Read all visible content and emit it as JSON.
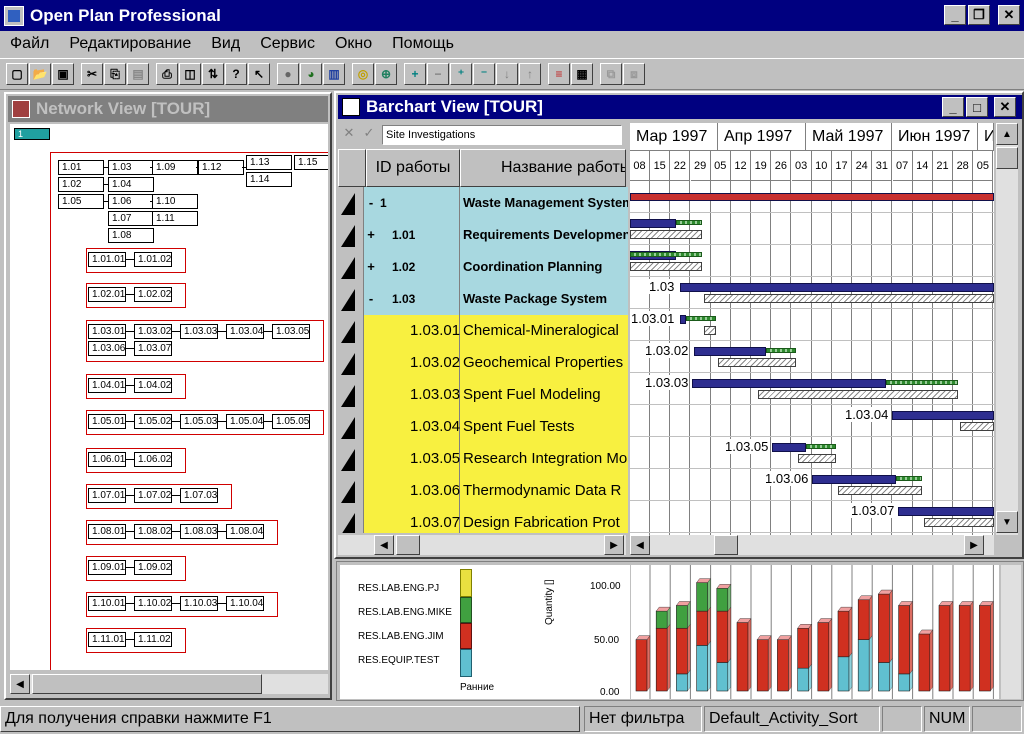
{
  "app": {
    "title": "Open Plan Professional"
  },
  "menu": [
    "Файл",
    "Редактирование",
    "Вид",
    "Сервис",
    "Окно",
    "Помощь"
  ],
  "network": {
    "title": "Network View [TOUR]",
    "root": "1",
    "top_nodes": [
      "1.01",
      "1.02",
      "1.05",
      "1.03",
      "1.04",
      "1.06",
      "1.07",
      "1.08",
      "1.10",
      "1.09",
      "1.11",
      "1.12",
      "1.13",
      "1.14",
      "1.15"
    ],
    "groups": [
      [
        "1.01.01",
        "1.01.02"
      ],
      [
        "1.02.01",
        "1.02.02"
      ],
      [
        "1.03.01",
        "1.03.02",
        "1.03.03",
        "1.03.04",
        "1.03.05",
        "1.03.06",
        "1.03.07"
      ],
      [
        "1.04.01",
        "1.04.02"
      ],
      [
        "1.05.01",
        "1.05.02",
        "1.05.03",
        "1.05.04",
        "1.05.05"
      ],
      [
        "1.06.01",
        "1.06.02"
      ],
      [
        "1.07.01",
        "1.07.02",
        "1.07.03"
      ],
      [
        "1.08.01",
        "1.08.02",
        "1.08.03",
        "1.08.04"
      ],
      [
        "1.09.01",
        "1.09.02"
      ],
      [
        "1.10.01",
        "1.10.02",
        "1.10.03",
        "1.10.04"
      ],
      [
        "1.11.01",
        "1.11.02"
      ]
    ]
  },
  "barchart": {
    "title": "Barchart View [TOUR]",
    "edit_value": "Site Investigations",
    "col_id": "ID работы",
    "col_name": "Название работы",
    "months": [
      "Мар 1997",
      "Апр 1997",
      "Май 1997",
      "Июн 1997",
      "И"
    ],
    "days": [
      "08",
      "15",
      "22",
      "29",
      "05",
      "12",
      "19",
      "26",
      "03",
      "10",
      "17",
      "24",
      "31",
      "07",
      "14",
      "21",
      "28",
      "05"
    ],
    "rows": [
      {
        "toggle": "-",
        "id": "1",
        "name": "Waste Management System",
        "label": "",
        "bg": "#a8d8e0",
        "bold": true
      },
      {
        "toggle": "+",
        "id": "1.01",
        "name": "Requirements Development",
        "label": "",
        "bg": "#a8d8e0",
        "bold": true
      },
      {
        "toggle": "+",
        "id": "1.02",
        "name": "Coordination Planning",
        "label": "",
        "bg": "#a8d8e0",
        "bold": true
      },
      {
        "toggle": "-",
        "id": "1.03",
        "name": "Waste Package System",
        "label": "1.03",
        "bg": "#a8d8e0",
        "bold": true
      },
      {
        "toggle": "",
        "id": "1.03.01",
        "name": "Chemical-Mineralogical",
        "label": "1.03.01",
        "bg": "#f8f040",
        "bold": false
      },
      {
        "toggle": "",
        "id": "1.03.02",
        "name": "Geochemical Properties",
        "label": "1.03.02",
        "bg": "#f8f040",
        "bold": false
      },
      {
        "toggle": "",
        "id": "1.03.03",
        "name": "Spent Fuel Modeling",
        "label": "1.03.03",
        "bg": "#f8f040",
        "bold": false
      },
      {
        "toggle": "",
        "id": "1.03.04",
        "name": "Spent Fuel Tests",
        "label": "1.03.04",
        "bg": "#f8f040",
        "bold": false
      },
      {
        "toggle": "",
        "id": "1.03.05",
        "name": "Research Integration Mo",
        "label": "1.03.05",
        "bg": "#f8f040",
        "bold": false
      },
      {
        "toggle": "",
        "id": "1.03.06",
        "name": "Thermodynamic Data R",
        "label": "1.03.06",
        "bg": "#f8f040",
        "bold": false
      },
      {
        "toggle": "",
        "id": "1.03.07",
        "name": "Design Fabrication Prot",
        "label": "1.03.07",
        "bg": "#f8f040",
        "bold": false
      }
    ]
  },
  "resources": {
    "legend": [
      "RES.LAB.ENG.PJ",
      "RES.LAB.ENG.MIKE",
      "RES.LAB.ENG.JIM",
      "RES.EQUIP.TEST"
    ],
    "legend_colors": [
      "#e8e040",
      "#40a040",
      "#d03020",
      "#60c0d0"
    ],
    "legend_caption": "Ранние",
    "ylabel": "Quantity []",
    "yticks": [
      "100.00",
      "50.00",
      "0.00"
    ]
  },
  "chart_data": {
    "type": "bar",
    "title": "",
    "ylabel": "Quantity []",
    "ylim": [
      0,
      100
    ],
    "series": [
      {
        "name": "RES.EQUIP.TEST",
        "values": [
          0,
          0,
          15,
          40,
          25,
          0,
          0,
          0,
          20,
          0,
          30,
          45,
          25,
          15,
          0,
          0,
          0,
          0
        ]
      },
      {
        "name": "RES.LAB.ENG.JIM",
        "values": [
          45,
          55,
          40,
          30,
          45,
          60,
          45,
          45,
          35,
          60,
          40,
          35,
          60,
          60,
          50,
          75,
          75,
          75
        ]
      },
      {
        "name": "RES.LAB.ENG.MIKE",
        "values": [
          0,
          15,
          20,
          25,
          20,
          0,
          0,
          0,
          0,
          0,
          0,
          0,
          0,
          0,
          0,
          0,
          0,
          0
        ]
      },
      {
        "name": "RES.LAB.ENG.PJ",
        "values": [
          0,
          0,
          0,
          0,
          0,
          0,
          0,
          0,
          0,
          0,
          0,
          0,
          0,
          0,
          0,
          0,
          0,
          0
        ]
      }
    ]
  },
  "status": {
    "help": "Для получения справки нажмите F1",
    "filter": "Нет фильтра",
    "sort": "Default_Activity_Sort",
    "num": "NUM"
  }
}
